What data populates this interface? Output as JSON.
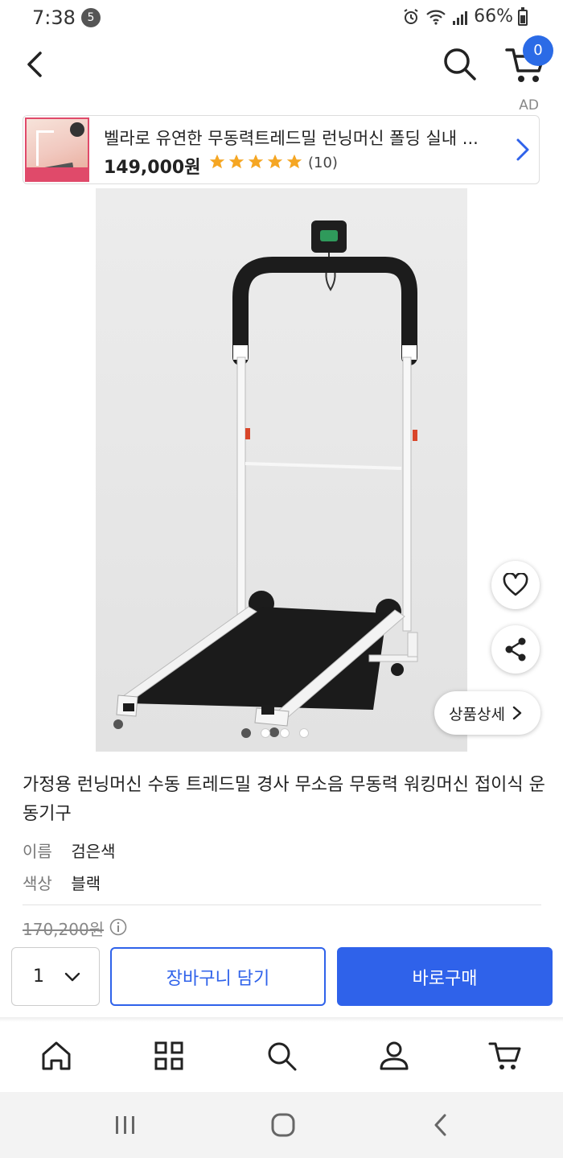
{
  "status_bar": {
    "time": "7:38",
    "notification_count": "5",
    "battery": "66%"
  },
  "header": {
    "cart_count": "0"
  },
  "ad": {
    "label": "AD",
    "title": "벨라로 유연한 무동력트레드밀 런닝머신 폴딩 실내 ...",
    "price": "149,000원",
    "rating_stars": 5,
    "review_count": "(10)"
  },
  "product": {
    "image_icon": "treadmill-photo",
    "carousel": {
      "total": 4,
      "active": 1
    },
    "detail_button": "상품상세",
    "title": "가정용 런닝머신 수동 트레드밀 경사 무소음 무동력 워킹머신 접이식 운동기구",
    "options": [
      {
        "label": "이름",
        "value": "검은색"
      },
      {
        "label": "색상",
        "value": "블랙"
      }
    ],
    "original_price": "170,200원"
  },
  "purchase": {
    "quantity": "1",
    "add_to_cart": "장바구니 담기",
    "buy_now": "바로구매"
  },
  "colors": {
    "primary_blue": "#2f62ea",
    "badge_blue": "#2b6be6",
    "star_yellow": "#f5a623"
  },
  "bottom_nav_icons": [
    "home-icon",
    "category-icon",
    "search-icon",
    "my-page-icon",
    "cart-icon"
  ]
}
